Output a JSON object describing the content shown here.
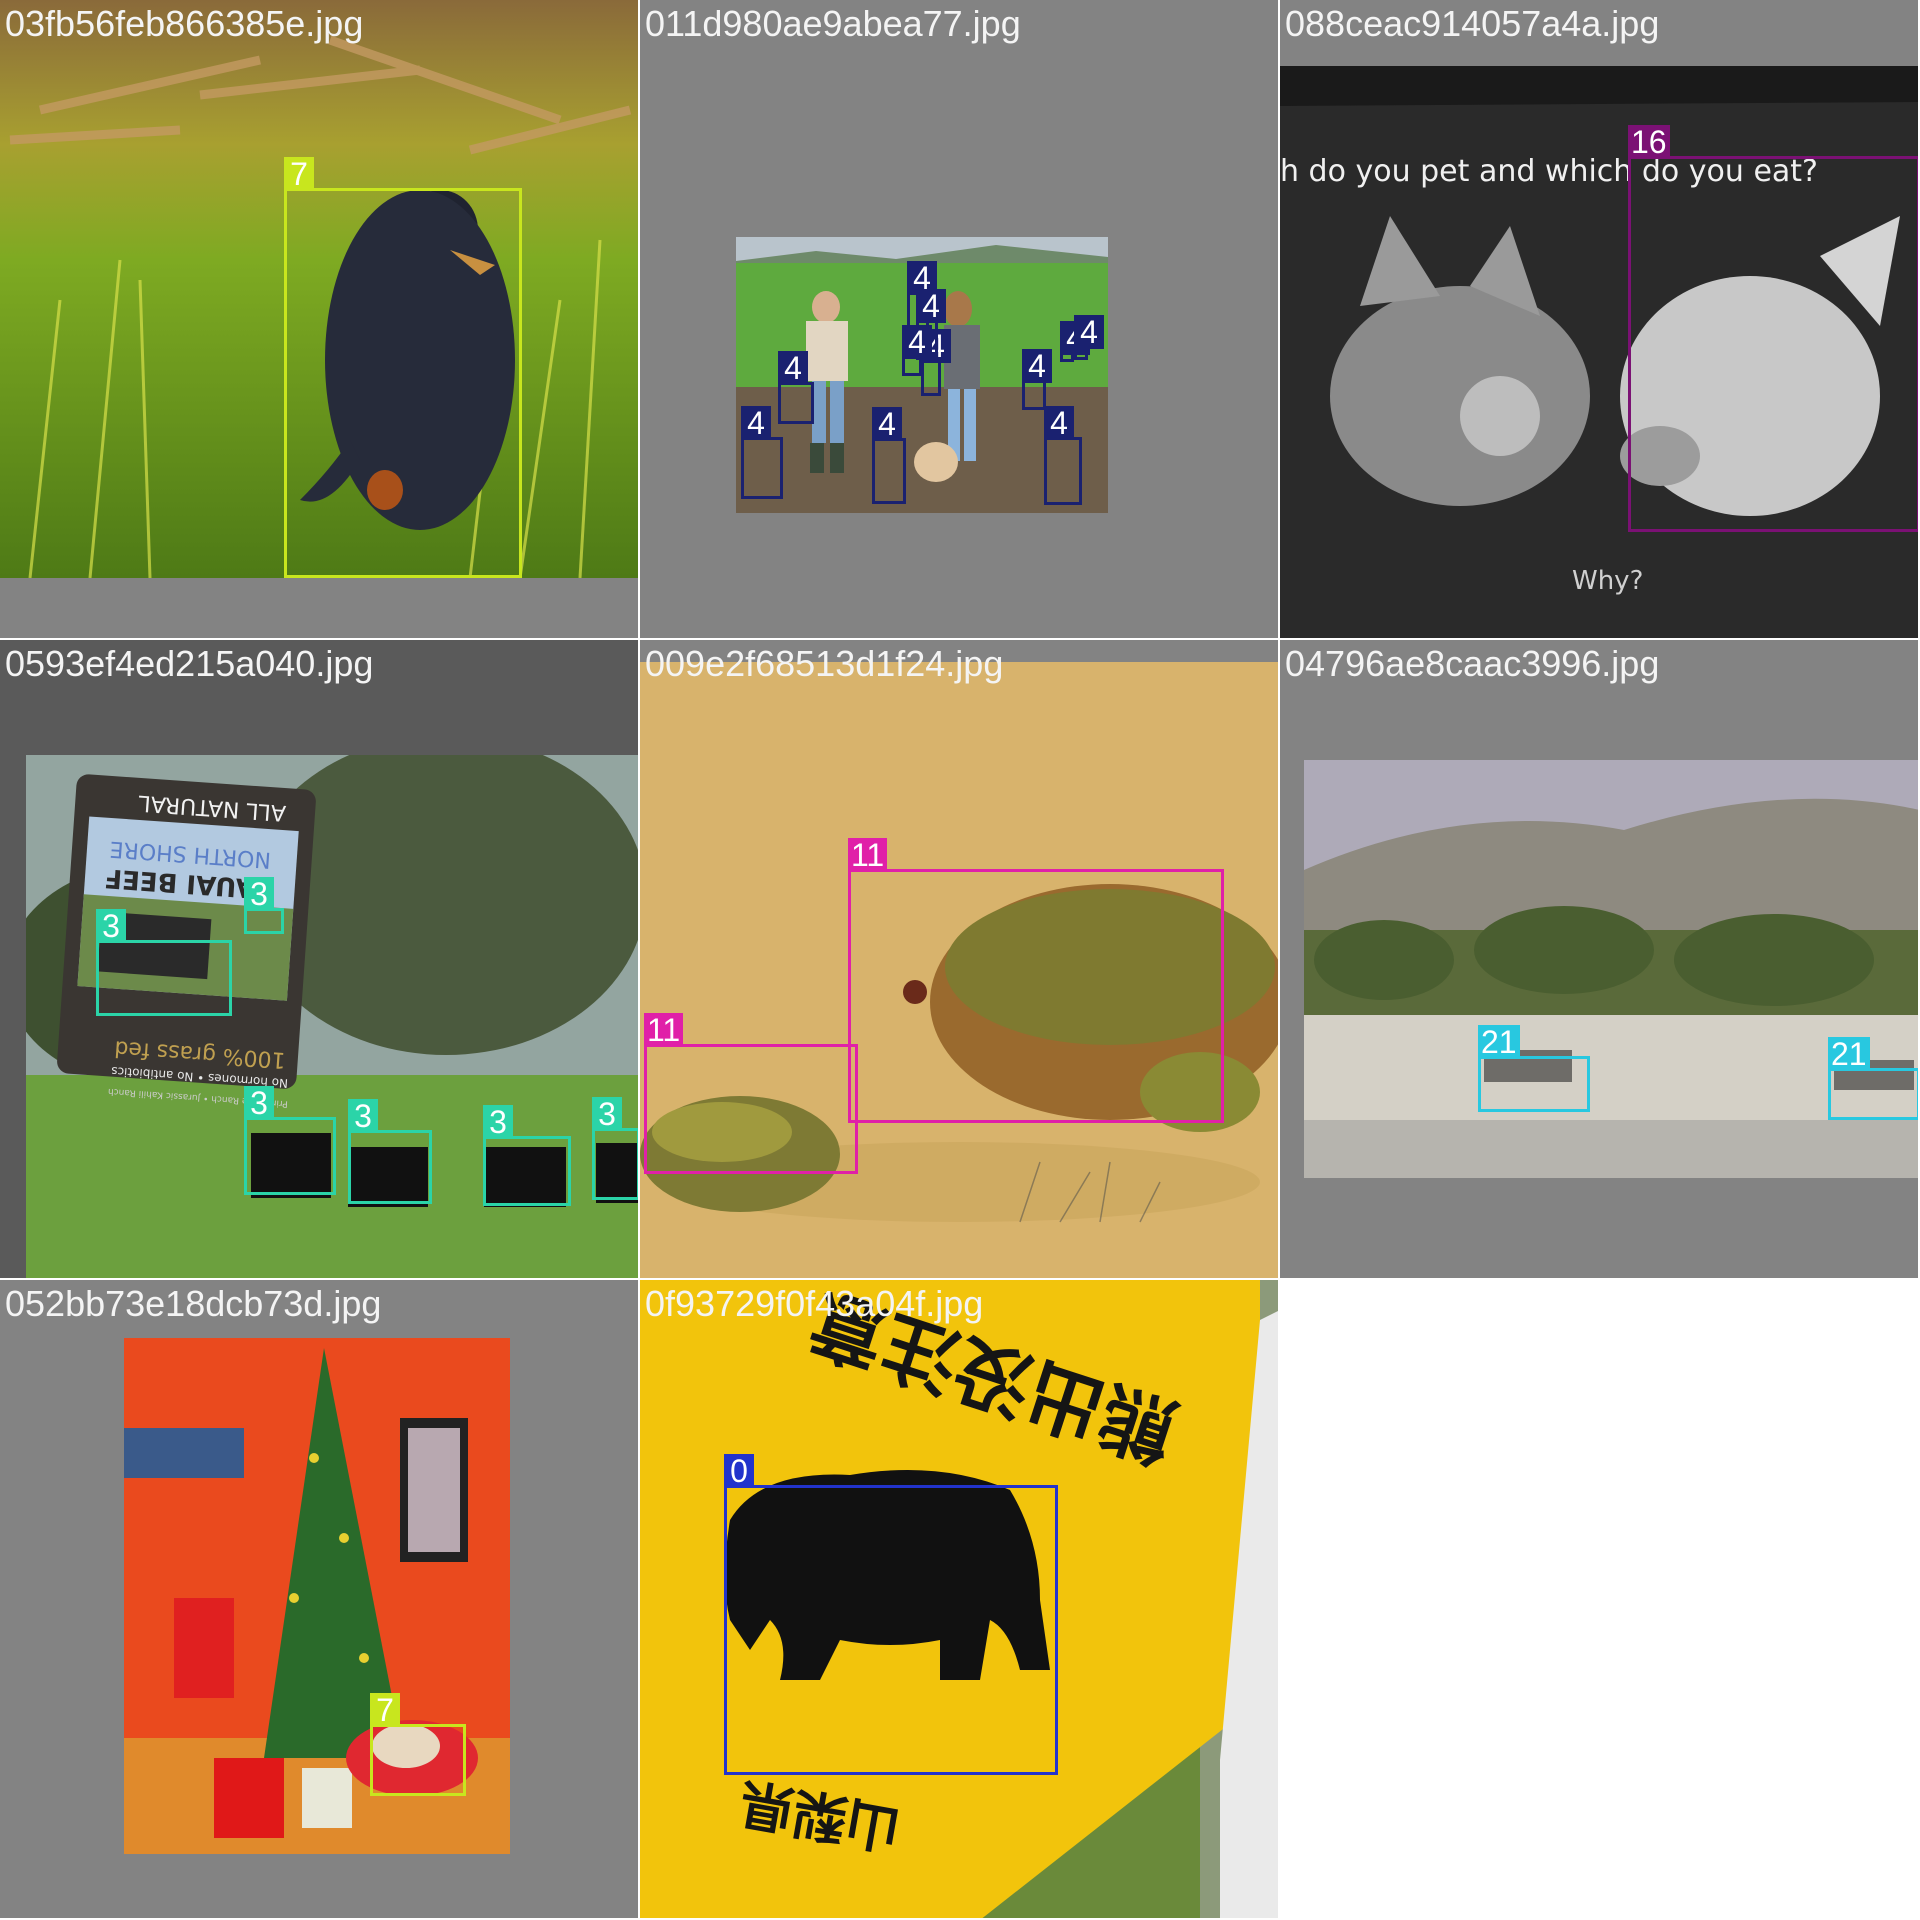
{
  "colors": {
    "class_0": "#2233cc",
    "class_3": "#2bd4a8",
    "class_4": "#1a2170",
    "class_7": "#c8e61e",
    "class_11": "#e020a8",
    "class_16": "#7b1174",
    "class_21": "#28c8e0"
  },
  "tiles": [
    {
      "filename": "03fb56feb866385e.jpg",
      "scene": "dog-in-grass",
      "boxes": [
        {
          "label": "7",
          "color_key": "class_7"
        }
      ]
    },
    {
      "filename": "011d980ae9abea77.jpg",
      "scene": "farm-chickens",
      "boxes": [
        {
          "label": "4"
        },
        {
          "label": "4"
        },
        {
          "label": "4"
        },
        {
          "label": "4"
        },
        {
          "label": "4"
        },
        {
          "label": "4"
        },
        {
          "label": "4"
        },
        {
          "label": "4"
        },
        {
          "label": "4"
        },
        {
          "label": "4"
        },
        {
          "label": "4"
        }
      ]
    },
    {
      "filename": "088ceac914057a4a.jpg",
      "scene": "cat-and-pig-poster",
      "sign_text_top": "h do you pet and which do you eat?",
      "sign_text_bottom": "Why?",
      "boxes": [
        {
          "label": "16"
        }
      ]
    },
    {
      "filename": "0593ef4ed215a040.jpg",
      "scene": "cattle-beef-sign",
      "sign_lines": [
        "ALL NATURAL",
        "NORTH SHORE",
        "KAUAI BEEF",
        "100% grass fed",
        "No hormones • No antibiotics",
        "Princeville Ranch • Jurassic Kahili Ranch"
      ],
      "boxes": [
        {
          "label": "3"
        },
        {
          "label": "3"
        },
        {
          "label": "3"
        },
        {
          "label": "3"
        },
        {
          "label": "3"
        },
        {
          "label": "3"
        }
      ]
    },
    {
      "filename": "009e2f68513d1f24.jpg",
      "scene": "frog-illustration",
      "boxes": [
        {
          "label": "11"
        },
        {
          "label": "11"
        }
      ]
    },
    {
      "filename": "04796ae8caac3996.jpg",
      "scene": "zebras-savanna",
      "boxes": [
        {
          "label": "21"
        },
        {
          "label": "21"
        }
      ]
    },
    {
      "filename": "052bb73e18dcb73d.jpg",
      "scene": "christmas-tree-dog",
      "boxes": [
        {
          "label": "7"
        }
      ]
    },
    {
      "filename": "0f93729f0f43a04f.jpg",
      "scene": "bear-warning-sign",
      "sign_top": "熊出没注意",
      "sign_bottom": "山梨県",
      "boxes": [
        {
          "label": "0"
        }
      ]
    }
  ]
}
